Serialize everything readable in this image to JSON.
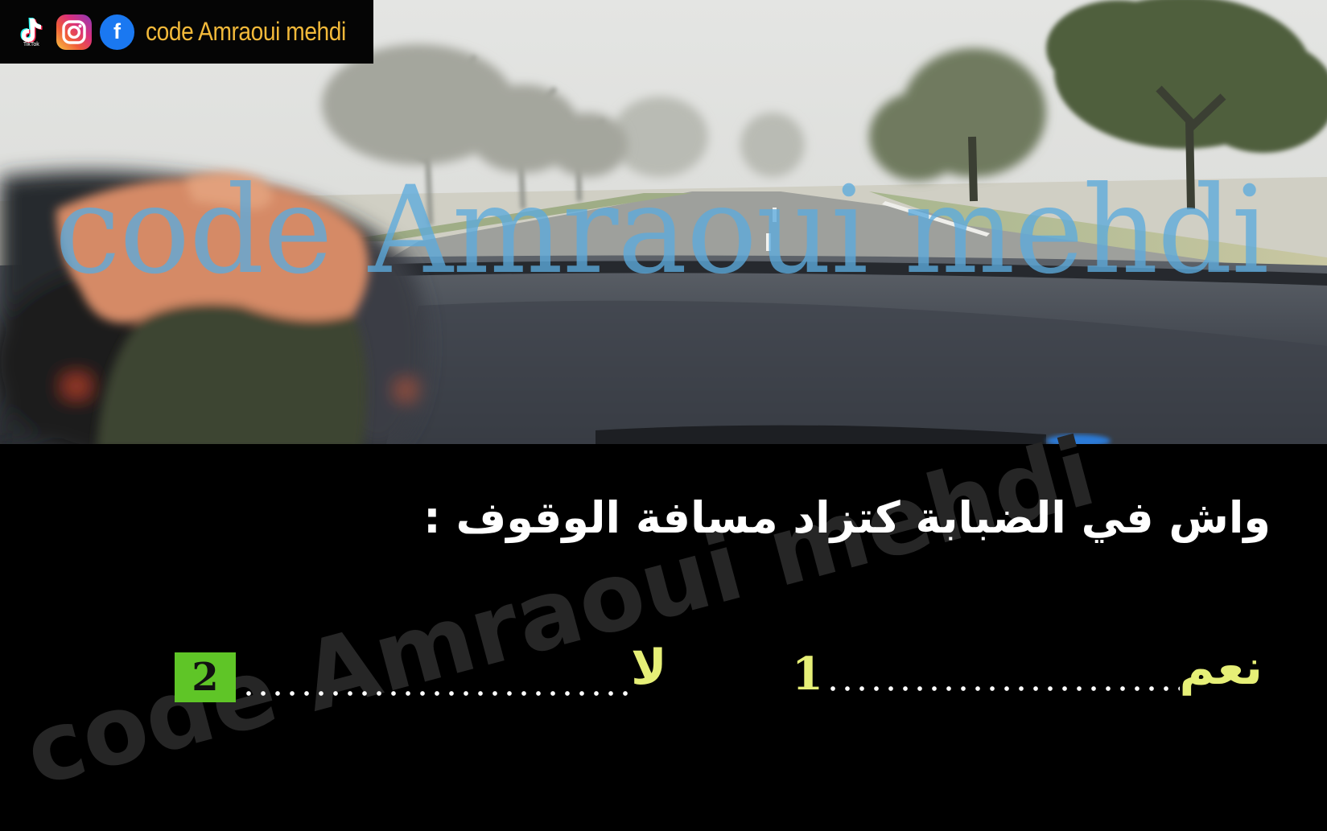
{
  "badge": {
    "text": "code Amraoui mehdi",
    "tiktok_caption": "TikTok",
    "facebook_letter": "f",
    "icons": [
      "tiktok-icon",
      "instagram-icon",
      "facebook-icon"
    ]
  },
  "watermarks": {
    "top": "code Amraoui mehdi",
    "bottom": "code Amraoui mehdi"
  },
  "question": {
    "text": "واش في الضبابة كتزاد مسافة الوقوف :"
  },
  "answers": [
    {
      "label": "نعم",
      "number": "1"
    },
    {
      "label": "لا",
      "number": "2",
      "selected": true
    }
  ],
  "colors": {
    "badge_text": "#f2b93a",
    "answer_text": "#e6ef77",
    "selected_badge": "#5fc527",
    "watermark_top": "#5caadc"
  }
}
